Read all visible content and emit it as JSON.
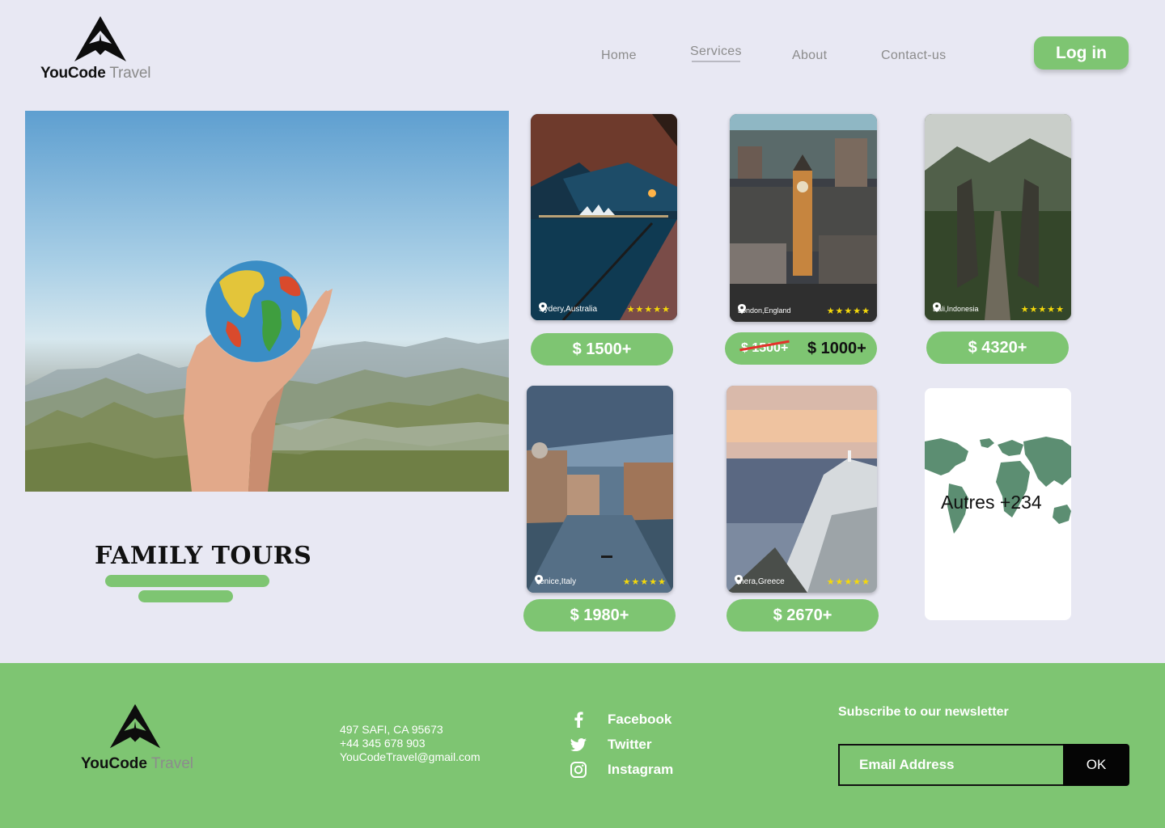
{
  "brand": {
    "name_part1": "YouCode",
    "name_part2": "Travel"
  },
  "nav": {
    "home": "Home",
    "services": "Services",
    "about": "About",
    "contact": "Contact-us",
    "active": "Services"
  },
  "login_label": "Log in",
  "hero": {
    "title": "FAMILY TOURS"
  },
  "destinations": [
    {
      "location": "Sydery,Australia",
      "stars": "★★★★★",
      "price": "$ 1500+"
    },
    {
      "location": "London,England",
      "stars": "★★★★★",
      "old_price": "$ 1500+",
      "price": "$ 1000+"
    },
    {
      "location": "Bali,Indonesia",
      "stars": "★★★★★",
      "price": "$ 4320+"
    },
    {
      "location": "Venice,Italy",
      "stars": "★★★★★",
      "price": "$ 1980+"
    },
    {
      "location": "Thera,Greece",
      "stars": "★★★★★",
      "price": "$ 2670+"
    }
  ],
  "others": "Autres +234",
  "footer": {
    "address_line1": "497  SAFI, CA 95673",
    "phone": "+44 345 678 903",
    "email": "YouCodeTravel@gmail.com",
    "social": {
      "facebook": "Facebook",
      "twitter": "Twitter",
      "instagram": "Instagram"
    },
    "newsletter_title": "Subscribe to our newsletter",
    "email_placeholder": "Email Address",
    "ok_label": "OK"
  },
  "colors": {
    "accent": "#7ec572",
    "background": "#e8e8f3",
    "star": "#f5d90a",
    "strike": "#e4322b"
  }
}
